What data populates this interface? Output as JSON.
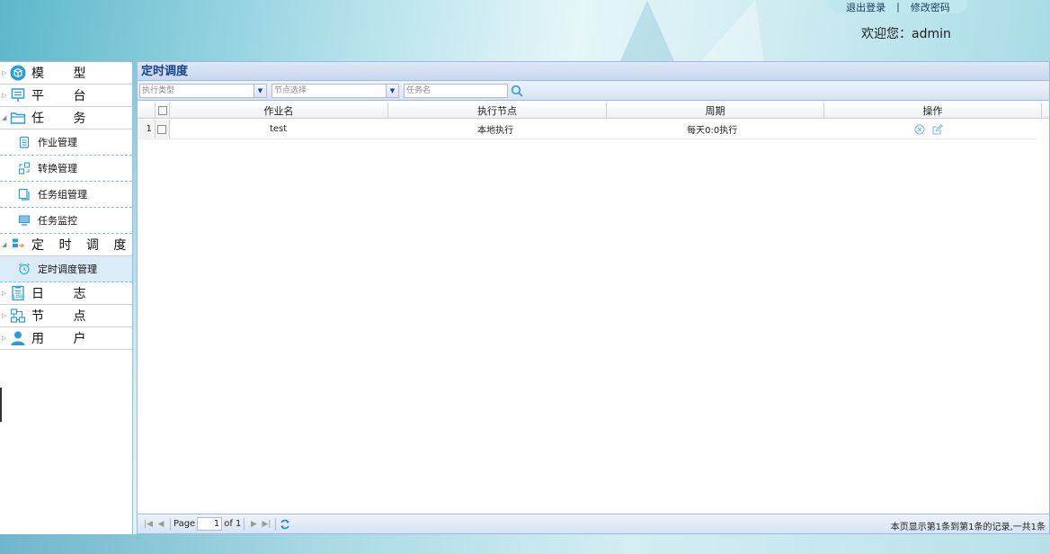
{
  "header": {
    "logout_label": "退出登录",
    "separator": "|",
    "change_password_label": "修改密码",
    "welcome_text": "欢迎您：admin"
  },
  "sidebar": {
    "groups": [
      {
        "label": "模 型",
        "icon": "cube-icon"
      },
      {
        "label": "平 台",
        "icon": "monitor-icon"
      },
      {
        "label": "任 务",
        "icon": "folder-icon",
        "items": [
          {
            "label": "作业管理",
            "icon": "clipboard-icon"
          },
          {
            "label": "转换管理",
            "icon": "transform-icon"
          },
          {
            "label": "任务组管理",
            "icon": "copy-icon"
          },
          {
            "label": "任务监控",
            "icon": "screen-icon"
          }
        ]
      },
      {
        "label": "定 时 调 度",
        "icon": "schedule-icon",
        "items": [
          {
            "label": "定时调度管理",
            "icon": "alarm-clock-icon",
            "active": true
          }
        ]
      },
      {
        "label": "日 志",
        "icon": "log-icon"
      },
      {
        "label": "节 点",
        "icon": "node-icon"
      },
      {
        "label": "用 户",
        "icon": "user-icon"
      }
    ]
  },
  "main": {
    "title": "定时调度",
    "toolbar": {
      "exec_type_placeholder": "执行类型",
      "node_select_placeholder": "节点选择",
      "task_name_placeholder": "任务名"
    },
    "columns": [
      "作业名",
      "执行节点",
      "周期",
      "操作"
    ],
    "rows": [
      {
        "num": "1",
        "name": "test",
        "node": "本地执行",
        "cycle": "每天0:0执行"
      }
    ],
    "pager": {
      "page_label": "Page",
      "page_value": "1",
      "of_label": "of 1",
      "status": "本页显示第1条到第1条的记录,一共1条"
    }
  },
  "colors": {
    "accent": "#15428b",
    "border": "#99bbe8",
    "active_bg": "#dcebf8",
    "icon_blue": "#2b9be0"
  }
}
